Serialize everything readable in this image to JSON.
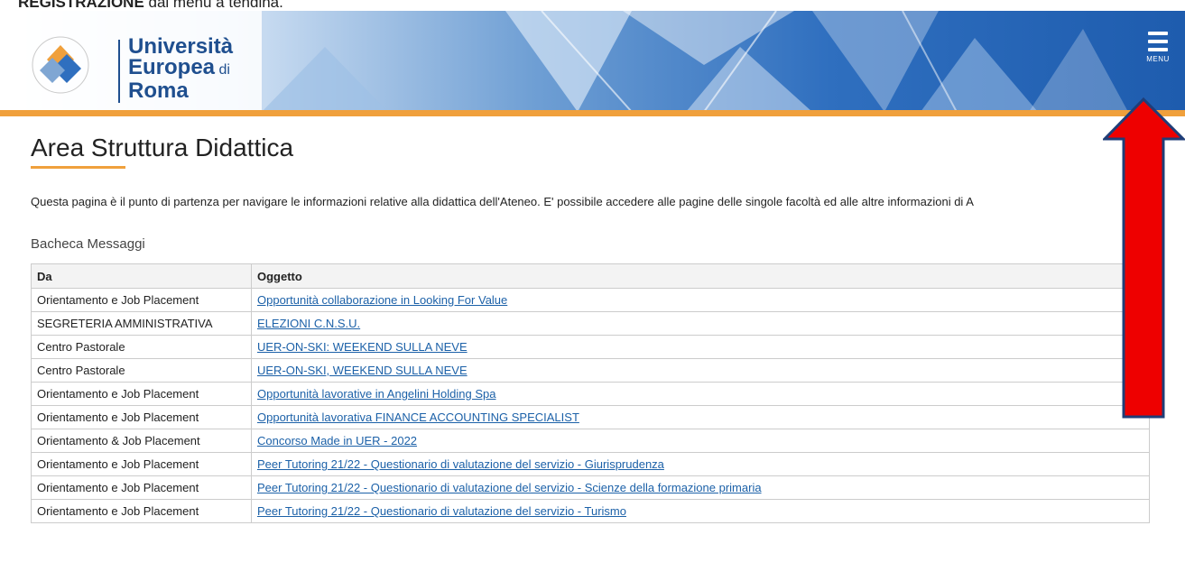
{
  "caption": {
    "bold": "REGISTRAZIONE",
    "rest": " dal menu a tendina."
  },
  "header": {
    "logo": {
      "line1": "Università",
      "line2_main": "Europea",
      "line2_small": " di",
      "line3": "Roma"
    },
    "menu_label": "MENU"
  },
  "colors": {
    "accent": "#f0a03c",
    "brand_blue": "#1f4f8f",
    "link": "#1c61a8",
    "annotation_arrow": "#ee0000"
  },
  "page": {
    "title": "Area Struttura Didattica",
    "intro": "Questa pagina è il punto di partenza per navigare le informazioni relative alla didattica dell'Ateneo. E' possibile accedere alle pagine delle singole facoltà ed alle altre informazioni di A",
    "section_label": "Bacheca Messaggi"
  },
  "table": {
    "headers": [
      "Da",
      "Oggetto"
    ],
    "rows": [
      {
        "da": "Orientamento e Job Placement",
        "oggetto": "Opportunità collaborazione in Looking For Value"
      },
      {
        "da": "SEGRETERIA AMMINISTRATIVA",
        "oggetto": "ELEZIONI C.N.S.U."
      },
      {
        "da": "Centro Pastorale",
        "oggetto": "UER-ON-SKI: WEEKEND SULLA NEVE"
      },
      {
        "da": "Centro Pastorale",
        "oggetto": "UER-ON-SKI, WEEKEND SULLA NEVE"
      },
      {
        "da": "Orientamento e Job Placement",
        "oggetto": "Opportunità lavorative in Angelini Holding Spa"
      },
      {
        "da": "Orientamento e Job Placement",
        "oggetto": "Opportunità lavorativa FINANCE ACCOUNTING SPECIALIST"
      },
      {
        "da": "Orientamento & Job Placement",
        "oggetto": "Concorso Made in UER - 2022"
      },
      {
        "da": "Orientamento e Job Placement",
        "oggetto": "Peer Tutoring 21/22 - Questionario di valutazione del servizio - Giurisprudenza"
      },
      {
        "da": "Orientamento e Job Placement",
        "oggetto": "Peer Tutoring 21/22 - Questionario di valutazione del servizio - Scienze della formazione primaria"
      },
      {
        "da": "Orientamento e Job Placement",
        "oggetto": "Peer Tutoring 21/22 - Questionario di valutazione del servizio - Turismo"
      }
    ]
  }
}
